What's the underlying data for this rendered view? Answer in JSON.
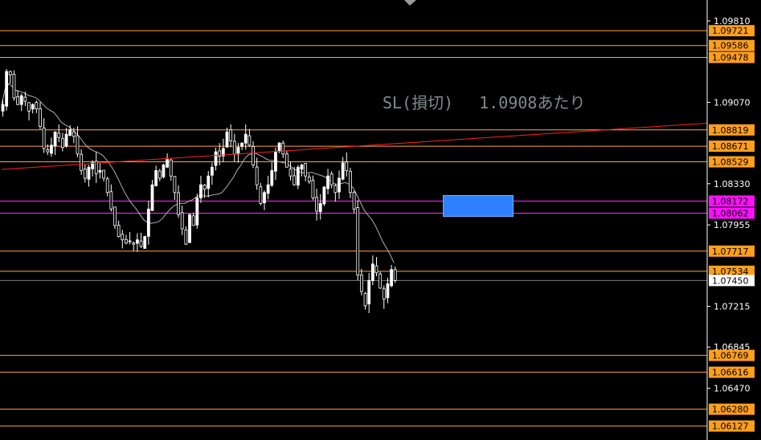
{
  "chart_data": {
    "type": "candlestick",
    "annotation": "SL(損切)　 1.0908あたり",
    "y_axis": {
      "min": 1.06,
      "max": 1.1,
      "ticks": [
        "1.09810",
        "1.09070",
        "1.08330",
        "1.07955",
        "1.07215",
        "1.06845",
        "1.06470"
      ]
    },
    "current_price": "1.07450",
    "levels": [
      {
        "value": 1.09721,
        "label": "1.09721",
        "color": "#ffa53d",
        "tag_color": "#ff9f1c"
      },
      {
        "value": 1.09586,
        "label": "1.09586",
        "color": "#ffa53d",
        "tag_color": "#ff9f1c"
      },
      {
        "value": 1.09478,
        "label": "1.09478",
        "color": "#ffa53d",
        "tag_color": "#ff9f1c"
      },
      {
        "value": 1.08819,
        "label": "1.08819",
        "color": "#ffa53d",
        "tag_color": "#ff9f1c"
      },
      {
        "value": 1.08671,
        "label": "1.08671",
        "color": "#ffa53d",
        "tag_color": "#ff9f1c"
      },
      {
        "value": 1.08529,
        "label": "1.08529",
        "color": "#ffa53d",
        "tag_color": "#ff9f1c"
      },
      {
        "value": 1.08172,
        "label": "1.08172",
        "color": "#ff2bff",
        "tag_color": "#ff10ff"
      },
      {
        "value": 1.08062,
        "label": "1.08062",
        "color": "#ff2bff",
        "tag_color": "#ff10ff"
      },
      {
        "value": 1.07717,
        "label": "1.07717",
        "color": "#ffa53d",
        "tag_color": "#ff9f1c"
      },
      {
        "value": 1.07534,
        "label": "1.07534",
        "color": "#ffa53d",
        "tag_color": "#ff9f1c"
      },
      {
        "value": 1.06769,
        "label": "1.06769",
        "color": "#ffa53d",
        "tag_color": "#ff9f1c"
      },
      {
        "value": 1.06616,
        "label": "1.06616",
        "color": "#ffa53d",
        "tag_color": "#ff9f1c"
      },
      {
        "value": 1.0628,
        "label": "1.06280",
        "color": "#ffa53d",
        "tag_color": "#ff9f1c"
      },
      {
        "value": 1.06127,
        "label": "1.06127",
        "color": "#ffa53d",
        "tag_color": "#ff9f1c"
      }
    ],
    "trendline": {
      "start_index": 0,
      "start_value": 1.0846,
      "end_index": 180,
      "end_value": 1.0888,
      "color": "#ff2020"
    },
    "zone": {
      "from": 1.08062,
      "to": 1.08172,
      "start_index": 107,
      "end_index": 124,
      "color": "#2f80ff"
    },
    "moving_average": {
      "color": "#b0b0b0"
    },
    "colors": {
      "bull": "#ffffff",
      "bear": "#ffffff",
      "background": "#000000",
      "axis": "#ffffff"
    },
    "closes": [
      1.0905,
      1.0935,
      1.0932,
      1.0911,
      1.0905,
      1.0913,
      1.0908,
      1.0899,
      1.0905,
      1.0901,
      1.0885,
      1.0865,
      1.0862,
      1.0868,
      1.088,
      1.0875,
      1.0866,
      1.0878,
      1.0882,
      1.0876,
      1.086,
      1.0845,
      1.0838,
      1.0848,
      1.0852,
      1.0842,
      1.0845,
      1.0838,
      1.0825,
      1.081,
      1.0795,
      1.0785,
      1.0782,
      1.0779,
      1.0781,
      1.0778,
      1.0782,
      1.0776,
      1.0785,
      1.081,
      1.0832,
      1.0845,
      1.0838,
      1.085,
      1.0855,
      1.084,
      1.0825,
      1.0805,
      1.0792,
      1.0778,
      1.0805,
      1.0795,
      1.082,
      1.0832,
      1.0828,
      1.084,
      1.0848,
      1.0862,
      1.0858,
      1.0865,
      1.088,
      1.0872,
      1.086,
      1.0866,
      1.087,
      1.0878,
      1.0868,
      1.085,
      1.0832,
      1.0815,
      1.0825,
      1.0832,
      1.0845,
      1.0862,
      1.087,
      1.086,
      1.0848,
      1.084,
      1.0832,
      1.0848,
      1.085,
      1.084,
      1.0835,
      1.082,
      1.0808,
      1.0815,
      1.083,
      1.084,
      1.0832,
      1.0825,
      1.0838,
      1.0852,
      1.0845,
      1.0825,
      1.081,
      1.075,
      1.0735,
      1.0722,
      1.0745,
      1.076,
      1.0752,
      1.0738,
      1.0728,
      1.0742,
      1.0755,
      1.0745
    ]
  }
}
